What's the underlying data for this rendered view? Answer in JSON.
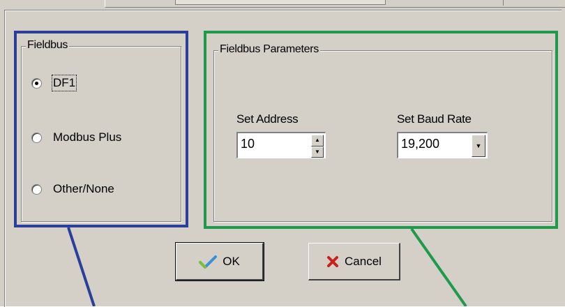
{
  "fieldbus": {
    "title": "Fieldbus",
    "options": [
      {
        "label": "DF1",
        "selected": true
      },
      {
        "label": "Modbus Plus",
        "selected": false
      },
      {
        "label": "Other/None",
        "selected": false
      }
    ]
  },
  "parameters": {
    "title": "Fieldbus Parameters",
    "address_label": "Set Address",
    "address_value": "10",
    "baud_label": "Set Baud Rate",
    "baud_value": "19,200"
  },
  "buttons": {
    "ok_label": "OK",
    "ok_icon": "checkmark-icon",
    "cancel_label": "Cancel",
    "cancel_icon": "x-icon"
  },
  "colors": {
    "fieldbus_highlight": "#2b3f9a",
    "parameters_highlight": "#1f9a4a",
    "dialog_bg": "#d4d0c8"
  }
}
